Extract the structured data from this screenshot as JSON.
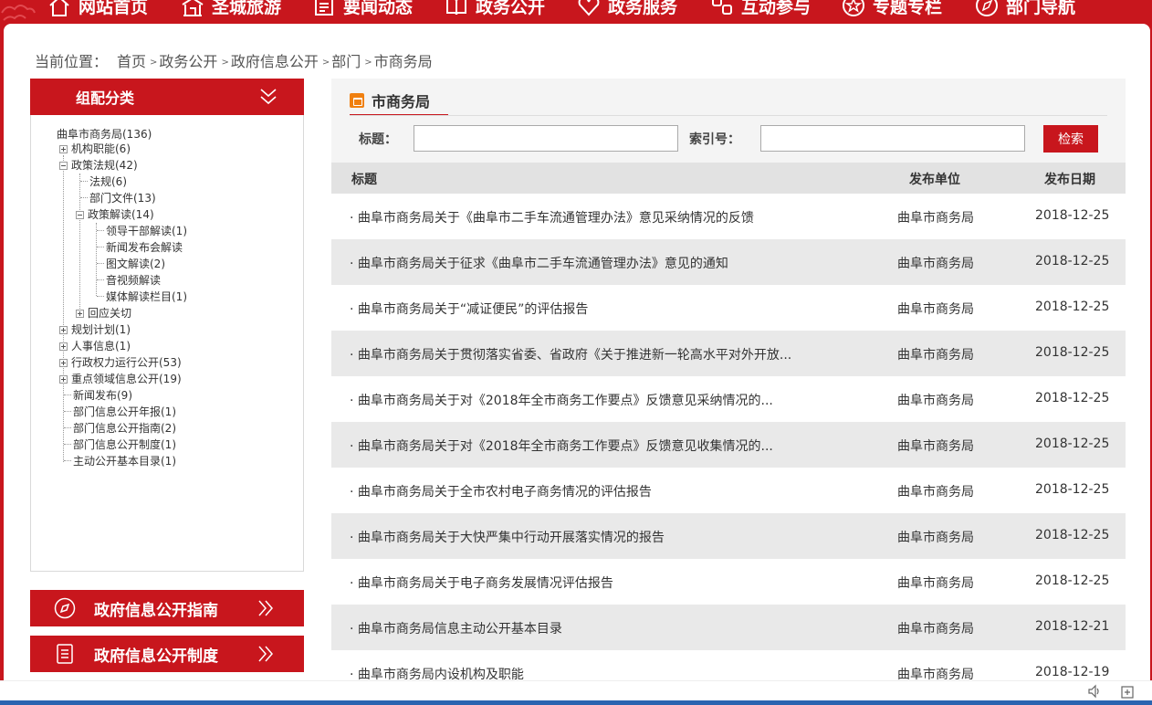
{
  "topnav": {
    "items": [
      {
        "label": "网站首页",
        "icon": "home-icon"
      },
      {
        "label": "圣城旅游",
        "icon": "temple-icon"
      },
      {
        "label": "要闻动态",
        "icon": "news-icon"
      },
      {
        "label": "政务公开",
        "icon": "book-icon"
      },
      {
        "label": "政务服务",
        "icon": "heart-icon"
      },
      {
        "label": "互动参与",
        "icon": "interact-icon"
      },
      {
        "label": "专题专栏",
        "icon": "star-icon"
      },
      {
        "label": "部门导航",
        "icon": "compass-icon"
      }
    ]
  },
  "breadcrumb": {
    "prefix": "当前位置：",
    "items": [
      "首页",
      "政务公开",
      "政府信息公开",
      "部门",
      "市商务局"
    ],
    "separator": ">"
  },
  "sidebar": {
    "header": "组配分类",
    "tree": [
      {
        "label": "曲阜市商务局(136)"
      },
      {
        "label": "机构职能(6)"
      },
      {
        "label": "政策法规(42)"
      },
      {
        "label": "法规(6)"
      },
      {
        "label": "部门文件(13)"
      },
      {
        "label": "政策解读(14)"
      },
      {
        "label": "领导干部解读(1)"
      },
      {
        "label": "新闻发布会解读"
      },
      {
        "label": "图文解读(2)"
      },
      {
        "label": "音视频解读"
      },
      {
        "label": "媒体解读栏目(1)"
      },
      {
        "label": "回应关切"
      },
      {
        "label": "规划计划(1)"
      },
      {
        "label": "人事信息(1)"
      },
      {
        "label": "行政权力运行公开(53)"
      },
      {
        "label": "重点领域信息公开(19)"
      },
      {
        "label": "新闻发布(9)"
      },
      {
        "label": "部门信息公开年报(1)"
      },
      {
        "label": "部门信息公开指南(2)"
      },
      {
        "label": "部门信息公开制度(1)"
      },
      {
        "label": "主动公开基本目录(1)"
      }
    ],
    "buttons": [
      {
        "label": "政府信息公开指南",
        "icon": "compass-icon"
      },
      {
        "label": "政府信息公开制度",
        "icon": "document-icon"
      }
    ]
  },
  "content": {
    "title": "市商务局",
    "search": {
      "title_label": "标题：",
      "title_value": "",
      "index_label": "索引号：",
      "index_value": "",
      "button": "检索"
    },
    "columns": [
      "标题",
      "发布单位",
      "发布日期"
    ],
    "rows": [
      {
        "title": "· 曲阜市商务局关于《曲阜市二手车流通管理办法》意见采纳情况的反馈",
        "unit": "曲阜市商务局",
        "date": "2018-12-25"
      },
      {
        "title": "· 曲阜市商务局关于征求《曲阜市二手车流通管理办法》意见的通知",
        "unit": "曲阜市商务局",
        "date": "2018-12-25"
      },
      {
        "title": "· 曲阜市商务局关于“减证便民”的评估报告",
        "unit": "曲阜市商务局",
        "date": "2018-12-25"
      },
      {
        "title": "· 曲阜市商务局关于贯彻落实省委、省政府《关于推进新一轮高水平对外开放...",
        "unit": "曲阜市商务局",
        "date": "2018-12-25"
      },
      {
        "title": "· 曲阜市商务局关于对《2018年全市商务工作要点》反馈意见采纳情况的...",
        "unit": "曲阜市商务局",
        "date": "2018-12-25"
      },
      {
        "title": "· 曲阜市商务局关于对《2018年全市商务工作要点》反馈意见收集情况的...",
        "unit": "曲阜市商务局",
        "date": "2018-12-25"
      },
      {
        "title": "· 曲阜市商务局关于全市农村电子商务情况的评估报告",
        "unit": "曲阜市商务局",
        "date": "2018-12-25"
      },
      {
        "title": "· 曲阜市商务局关于大快严集中行动开展落实情况的报告",
        "unit": "曲阜市商务局",
        "date": "2018-12-25"
      },
      {
        "title": "· 曲阜市商务局关于电子商务发展情况评估报告",
        "unit": "曲阜市商务局",
        "date": "2018-12-25"
      },
      {
        "title": "· 曲阜市商务局信息主动公开基本目录",
        "unit": "曲阜市商务局",
        "date": "2018-12-21"
      },
      {
        "title": "· 曲阜市商务局内设机构及职能",
        "unit": "曲阜市商务局",
        "date": "2018-12-19"
      }
    ]
  },
  "utility": {
    "icons": [
      "speaker-icon",
      "add-tab-icon"
    ]
  },
  "colors": {
    "brand_red": "#c8161d",
    "row_alt": "#e9e9e9",
    "accent_orange": "#f08010"
  }
}
